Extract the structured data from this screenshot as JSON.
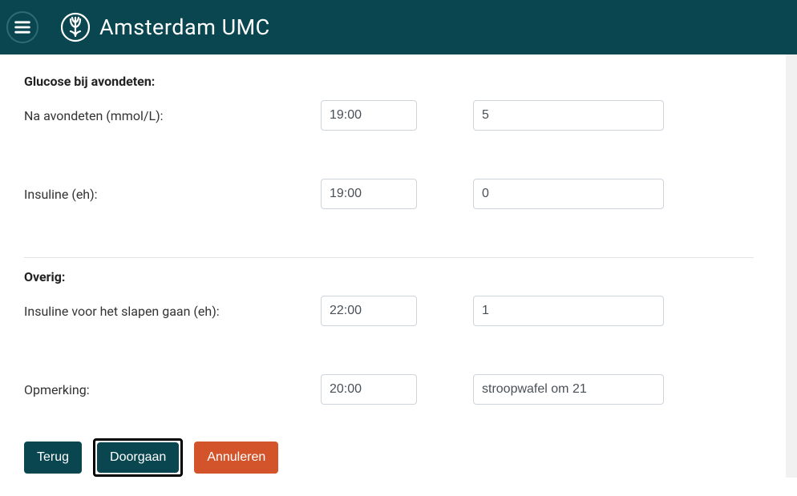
{
  "header": {
    "title": "Amsterdam UMC"
  },
  "sections": {
    "glucose_dinner": {
      "title": "Glucose bij avondeten:",
      "after_dinner": {
        "label": "Na avondeten (mmol/L):",
        "time": "19:00",
        "value": "5"
      },
      "insulin": {
        "label": "Insuline (eh):",
        "time": "19:00",
        "value": "0"
      }
    },
    "other": {
      "title": "Overig:",
      "insulin_sleep": {
        "label": "Insuline voor het slapen gaan (eh):",
        "time": "22:00",
        "value": "1"
      },
      "remark": {
        "label": "Opmerking:",
        "time": "20:00",
        "value": "stroopwafel om 21"
      }
    }
  },
  "buttons": {
    "back": "Terug",
    "continue": "Doorgaan",
    "cancel": "Annuleren"
  }
}
